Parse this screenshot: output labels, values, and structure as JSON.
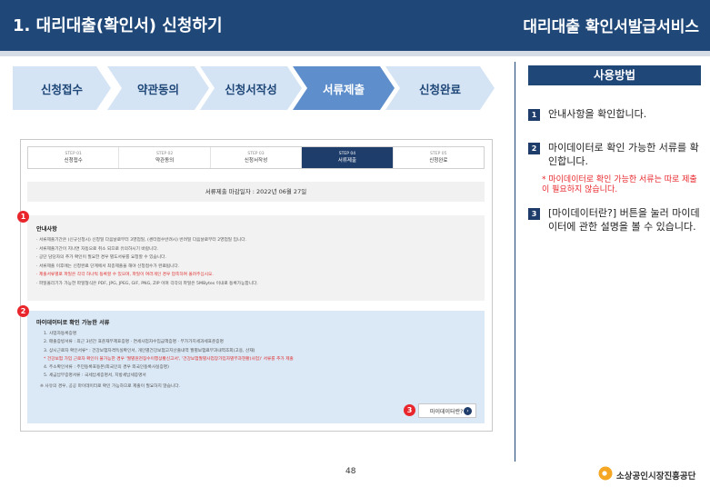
{
  "header": {
    "title_left": "1. 대리대출(확인서) 신청하기",
    "title_right": "대리대출 확인서발급서비스"
  },
  "steps": [
    "신청접수",
    "약관동의",
    "신청서작성",
    "서류제출",
    "신청완료"
  ],
  "active_step": "서류제출",
  "screenshot": {
    "mini_steps": [
      {
        "no": "STEP 01",
        "label": "신청접수"
      },
      {
        "no": "STEP 02",
        "label": "약관동의"
      },
      {
        "no": "STEP 03",
        "label": "신청서작성"
      },
      {
        "no": "STEP 04",
        "label": "서류제출"
      },
      {
        "no": "STEP 05",
        "label": "신청완료"
      }
    ],
    "deadline": "서류제출 마감일자 : 2022년 06월 27일",
    "notice": {
      "title": "안내사항",
      "lines": [
        {
          "text": "· 서류제출기간은 (신규신청시) 신청일 다음날로부터 3영업일, (센터접수반려시) 반려일 다음날로부터 2영업일 입니다.",
          "red": false
        },
        {
          "text": "· 서류제출기간이 지나면 자동으로 취소 되므로 유의하시기 바랍니다.",
          "red": false
        },
        {
          "text": "· 공단 담당자의 추가 확인이 필요한 경우 별도서류를 요청할 수 있습니다.",
          "red": false
        },
        {
          "text": "· 서류제출 이후에는 신청완료 단계에서 최종제출을 해야 신청접수가 완료됩니다.",
          "red": false
        },
        {
          "text": "· 제출서류별로 파일은 각각 하나씩 등록할 수 있으며, 파일이 여러개인 경우 압축하여 올려주십시오.",
          "red": true
        },
        {
          "text": "· 파일올리기가 가능한 파일형식은 PDF, JPG, JPEG, GIF, PNG, ZIP 이며 각각의 파일은 5MBytes 이내로 등록가능합니다.",
          "red": false
        }
      ]
    },
    "mydata": {
      "title": "마이데이터로 확인 가능한 서류",
      "lines": [
        {
          "text": "1. 사업자등록증명",
          "red": false
        },
        {
          "text": "2. 매출증빙서류 : 최근 3년간 표준재무제표증명 · 면세사업자수입금액증명 · 부가가치세과세표준증명",
          "red": false
        },
        {
          "text": "3. 상시근로자 확인서류* : 건강보험자격득실확인서, 개인별건강보험고지산출내역 월별보험료부과내역조회(고용, 산재)",
          "red": false
        },
        {
          "text": "* 건강보험 가입 근로자 확인이 불가능한 경우 '월별원천징수이행상황신고서', '건강보험월별사업장가입자별부과현황(사업)' 서류를 추가 제출",
          "red": true
        },
        {
          "text": "4. 주소확인서류 : 주민등록표등본(외국인의 경우 외국인등록사실증명)",
          "red": false
        },
        {
          "text": "5. 세금납부증명서류 : 국세납세증명서, 지방세납세증명서",
          "red": false
        }
      ],
      "note": "※ 사유의 경우, 공공 마이데이터로 확인 가능하므로 제출이 필요하지 않습니다.",
      "button_label": "마이데이터란?"
    },
    "badges": [
      "1",
      "2",
      "3"
    ]
  },
  "usage": {
    "title": "사용방법",
    "items": [
      {
        "num": "1",
        "text": "안내사항을 확인합니다."
      },
      {
        "num": "2",
        "text": "마이데이터로 확인 가능한 서류를 확인합니다."
      },
      {
        "num": "3",
        "text": "[마이데이터란?] 버튼을 눌러 마이데이터에 관한 설명을 볼 수 있습니다."
      }
    ],
    "note": "* 마이데이터로 확인 가능한 서류는 따로 제출이 필요하지 않습니다."
  },
  "footer": {
    "page_number": "48",
    "org_name": "소상공인시장진흥공단"
  },
  "colors": {
    "primary": "#1f4778",
    "step_bg": "#d5e4f5",
    "step_active": "#5e8ecb",
    "badge_red": "#e8262b",
    "mydata_bg": "#dbe8f5"
  }
}
